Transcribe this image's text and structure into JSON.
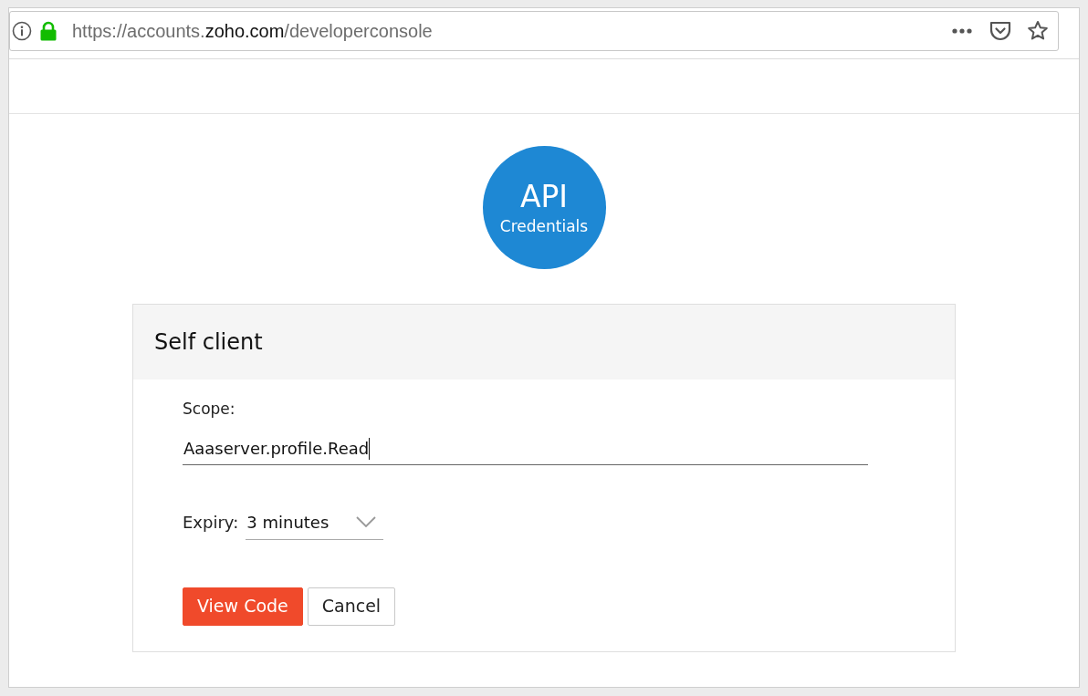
{
  "address_bar": {
    "url_prefix": "https://accounts.",
    "url_domain": "zoho.com",
    "url_path": "/developerconsole"
  },
  "badge": {
    "title": "API",
    "subtitle": "Credentials"
  },
  "card": {
    "title": "Self client",
    "scope": {
      "label": "Scope:",
      "value": "Aaaserver.profile.Read"
    },
    "expiry": {
      "label": "Expiry:",
      "value": "3 minutes"
    },
    "buttons": [
      {
        "label": "View Code",
        "kind": "primary"
      },
      {
        "label": "Cancel",
        "kind": "secondary"
      }
    ]
  }
}
